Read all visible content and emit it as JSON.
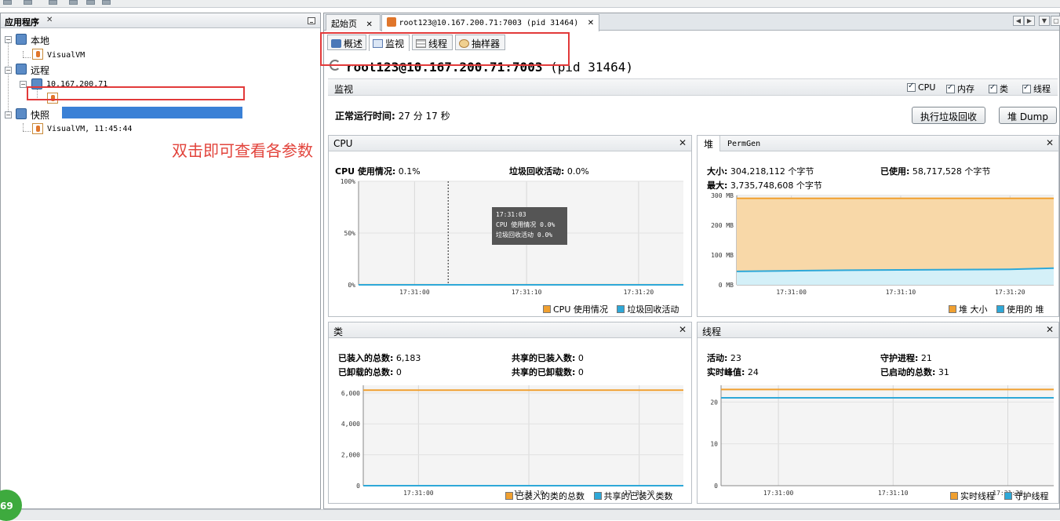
{
  "annotation": {
    "text": "双击即可查看各参数",
    "color": "#e2443c"
  },
  "apps": {
    "title": "应用程序",
    "local_label": "本地",
    "local_child": "VisualVM",
    "remote_label": "远程",
    "remote_host": "10.167.200.71",
    "remote_process": "root123@10.167.200.71:7003 (pid 31464)",
    "snapshots_label": "快照",
    "snapshot_child": "VisualVM, 11:45:44"
  },
  "editor": {
    "tabs": [
      {
        "label": "起始页"
      },
      {
        "label": "root123@10.167.200.71:7003 (pid 31464)"
      }
    ],
    "sub_tabs": [
      {
        "label": "概述"
      },
      {
        "label": "监视"
      },
      {
        "label": "线程"
      },
      {
        "label": "抽样器"
      }
    ],
    "process_title_bold": "root123@10.167.200.71:7003",
    "process_title_pid": "(pid 31464)"
  },
  "monitor": {
    "label": "监视",
    "checks": [
      {
        "label": "CPU",
        "checked": true
      },
      {
        "label": "内存",
        "checked": true
      },
      {
        "label": "类",
        "checked": true
      },
      {
        "label": "线程",
        "checked": true
      }
    ],
    "uptime_label": "正常运行时间:",
    "uptime_value": "27 分 17 秒",
    "gc_button": "执行垃圾回收",
    "heap_dump_button": "堆 Dump"
  },
  "panels": {
    "cpu": {
      "title": "CPU",
      "usage_label": "CPU 使用情况:",
      "usage_value": "0.1%",
      "gc_label": "垃圾回收活动:",
      "gc_value": "0.0%",
      "yticks": [
        "100%",
        "50%",
        "0%"
      ],
      "xticks": [
        "17:31:00",
        "17:31:10",
        "17:31:20"
      ],
      "tooltip": {
        "time": "17:31:03",
        "line1": "CPU 使用情况  0.0%",
        "line2": "垃圾回收活动  0.0%"
      },
      "legend": [
        "CPU 使用情况",
        "垃圾回收活动"
      ]
    },
    "heap": {
      "tab1": "堆",
      "tab2": "PermGen",
      "size_label": "大小:",
      "size_value": "304,218,112 个字节",
      "used_label": "已使用:",
      "used_value": "58,717,528 个字节",
      "max_label": "最大:",
      "max_value": "3,735,748,608 个字节",
      "yticks": [
        "300 MB",
        "200 MB",
        "100 MB",
        "0 MB"
      ],
      "xticks": [
        "17:31:00",
        "17:31:10",
        "17:31:20"
      ],
      "legend": [
        "堆 大小",
        "使用的 堆"
      ]
    },
    "classes": {
      "title": "类",
      "loaded_label": "已装入的总数:",
      "loaded_value": "6,183",
      "shared_loaded_label": "共享的已装入数:",
      "shared_loaded_value": "0",
      "unloaded_label": "已卸载的总数:",
      "unloaded_value": "0",
      "shared_unloaded_label": "共享的已卸载数:",
      "shared_unloaded_value": "0",
      "yticks": [
        "6,000",
        "4,000",
        "2,000",
        "0"
      ],
      "xticks": [
        "17:31:00",
        "17:31:10",
        "17:31:20"
      ],
      "legend": [
        "已装入的类的总数",
        "共享的已装入类数"
      ]
    },
    "threads": {
      "title": "线程",
      "live_label": "活动:",
      "live_value": "23",
      "daemon_label": "守护进程:",
      "daemon_value": "21",
      "peak_label": "实时峰值:",
      "peak_value": "24",
      "started_label": "已启动的总数:",
      "started_value": "31",
      "yticks": [
        "20",
        "10",
        "0"
      ],
      "xticks": [
        "17:31:00",
        "17:31:10",
        "17:31:20"
      ],
      "legend": [
        "实时线程",
        "守护线程"
      ]
    }
  },
  "status_badge": "69",
  "colors": {
    "orange": "#f0a030",
    "blue": "#2ea8d8",
    "heap_fill": "#f8d8a8",
    "used_fill": "#d4f0f8",
    "selection": "#3a80d6"
  },
  "chart_data": [
    {
      "type": "area",
      "title": "CPU",
      "x": [
        "17:30:55",
        "17:31:00",
        "17:31:05",
        "17:31:10",
        "17:31:15",
        "17:31:20",
        "17:31:24"
      ],
      "series": [
        {
          "name": "CPU 使用情况",
          "values": [
            0.1,
            0.1,
            0.0,
            0.1,
            0.1,
            0.1,
            0.1
          ]
        },
        {
          "name": "垃圾回收活动",
          "values": [
            0.0,
            0.0,
            0.0,
            0.0,
            0.0,
            0.0,
            0.0
          ]
        }
      ],
      "ylim": [
        0,
        100
      ],
      "ylabel": "%"
    },
    {
      "type": "area",
      "title": "堆",
      "x": [
        "17:30:55",
        "17:31:00",
        "17:31:05",
        "17:31:10",
        "17:31:15",
        "17:31:20",
        "17:31:24"
      ],
      "series": [
        {
          "name": "堆 大小",
          "values": [
            290,
            290,
            290,
            290,
            290,
            290,
            290
          ]
        },
        {
          "name": "使用的 堆",
          "values": [
            45,
            47,
            49,
            50,
            51,
            52,
            56
          ]
        }
      ],
      "ylim": [
        0,
        300
      ],
      "ylabel": "MB"
    },
    {
      "type": "line",
      "title": "类",
      "x": [
        "17:30:55",
        "17:31:00",
        "17:31:10",
        "17:31:20",
        "17:31:24"
      ],
      "series": [
        {
          "name": "已装入的类的总数",
          "values": [
            6183,
            6183,
            6183,
            6183,
            6183
          ]
        },
        {
          "name": "共享的已装入类数",
          "values": [
            0,
            0,
            0,
            0,
            0
          ]
        }
      ],
      "ylim": [
        0,
        6500
      ]
    },
    {
      "type": "line",
      "title": "线程",
      "x": [
        "17:30:55",
        "17:31:00",
        "17:31:10",
        "17:31:20",
        "17:31:24"
      ],
      "series": [
        {
          "name": "实时线程",
          "values": [
            23,
            23,
            23,
            23,
            23
          ]
        },
        {
          "name": "守护线程",
          "values": [
            21,
            21,
            21,
            21,
            21
          ]
        }
      ],
      "ylim": [
        0,
        24
      ]
    }
  ]
}
